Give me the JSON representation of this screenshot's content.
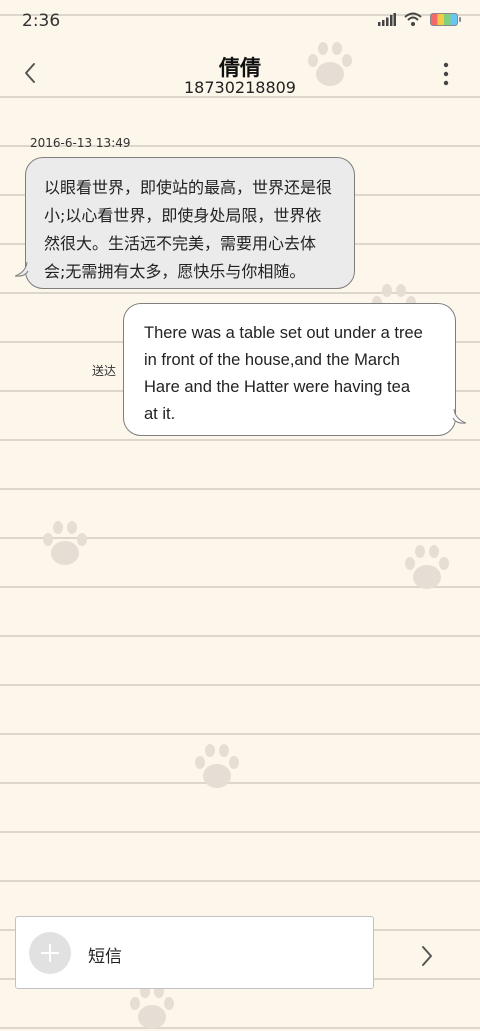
{
  "status_bar": {
    "time": "2:36",
    "icons": [
      "signal-icon",
      "wifi-icon",
      "battery-icon"
    ]
  },
  "header": {
    "contact_name": "倩倩",
    "phone_number": "18730218809",
    "back_icon": "chevron-left-icon",
    "more_icon": "more-vertical-icon"
  },
  "conversation": {
    "timestamp": "2016-6-13 13:49",
    "incoming": {
      "lines": [
        "以眼看世界，即使站的最高，世界还是很",
        "小;以心看世界，即使身处局限，世界依",
        "然很大。生活远不完美，需要用心去体",
        "会;无需拥有太多，愿快乐与你相随。"
      ],
      "bubble_color": "#ebebeb"
    },
    "outgoing": {
      "lines": [
        "There was a table set out under a tree",
        "in front of the house,and the March",
        "Hare and the Hatter were having tea",
        "at it."
      ],
      "status": "送达",
      "bubble_color": "#ffffff"
    }
  },
  "composer": {
    "placeholder": "短信",
    "add_icon": "plus-icon",
    "send_icon": "chevron-right-icon"
  },
  "theme": {
    "background": "#fdf6ea",
    "line_color": "#ddd6cc",
    "paw_color": "#e6ddd4"
  }
}
